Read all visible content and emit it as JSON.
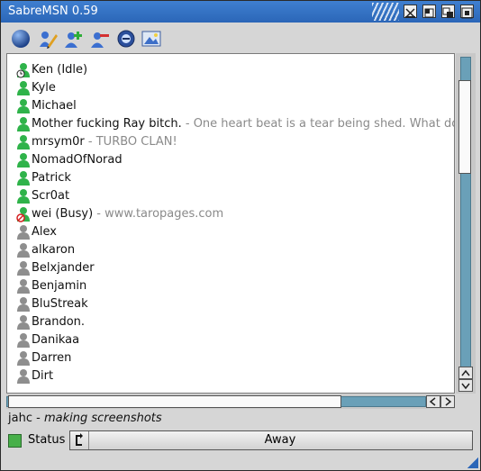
{
  "window": {
    "title": "SabreMSN 0.59"
  },
  "toolbar": {
    "tools": [
      "online-status-icon",
      "edit-icon",
      "add-contact-icon",
      "remove-contact-icon",
      "search-icon",
      "picture-icon"
    ]
  },
  "contacts": [
    {
      "name": "Ken (Idle)",
      "message": "",
      "state": "idle"
    },
    {
      "name": "Kyle",
      "message": "",
      "state": "online"
    },
    {
      "name": "Michael",
      "message": "",
      "state": "online"
    },
    {
      "name": "Mother fucking Ray bitch.",
      "message": "One heart beat is a tear being shed. What do y",
      "state": "online"
    },
    {
      "name": "mrsym0r",
      "message": "TURBO CLAN!",
      "state": "online"
    },
    {
      "name": "NomadOfNorad",
      "message": "",
      "state": "online"
    },
    {
      "name": "Patrick",
      "message": "",
      "state": "online"
    },
    {
      "name": "Scr0at",
      "message": "",
      "state": "online"
    },
    {
      "name": "wei (Busy)",
      "message": "www.taropages.com",
      "state": "busy"
    },
    {
      "name": "Alex",
      "message": "",
      "state": "offline"
    },
    {
      "name": "alkaron",
      "message": "",
      "state": "offline"
    },
    {
      "name": "Belxjander",
      "message": "",
      "state": "offline"
    },
    {
      "name": "Benjamin",
      "message": "",
      "state": "offline"
    },
    {
      "name": "BluStreak",
      "message": "",
      "state": "offline"
    },
    {
      "name": "Brandon.",
      "message": "",
      "state": "offline"
    },
    {
      "name": "Danikaa",
      "message": "",
      "state": "offline"
    },
    {
      "name": "Darren",
      "message": "",
      "state": "offline"
    },
    {
      "name": "Dirt",
      "message": "",
      "state": "offline"
    }
  ],
  "separator": " - ",
  "self": {
    "name": "jahc",
    "separator": " - ",
    "message": "making screenshots"
  },
  "statusbar": {
    "label": "Status",
    "value": "Away",
    "swatch_color": "#48b04a"
  },
  "colors": {
    "online": "#2fb34a",
    "offline": "#8e8e8e",
    "accent": "#2b66b8",
    "track": "#6aa0b8"
  }
}
